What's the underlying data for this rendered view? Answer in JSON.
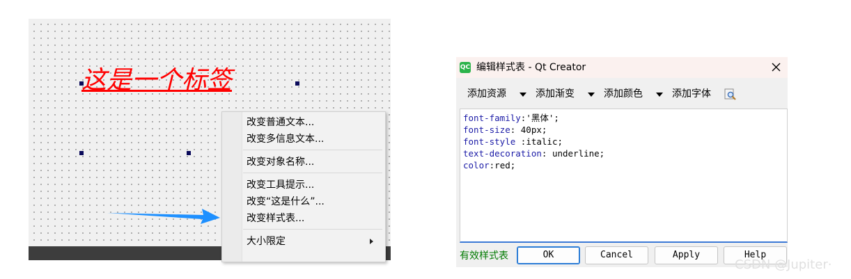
{
  "designer": {
    "label_text": "这是一个标签",
    "label_color": "#ff0000"
  },
  "context_menu": {
    "items": [
      {
        "label": "改变普通文本..."
      },
      {
        "label": "改变多信息文本..."
      },
      {
        "label": "改变对象名称..."
      },
      {
        "label": "改变工具提示..."
      },
      {
        "label": "改变“这是什么”..."
      },
      {
        "label": "改变样式表..."
      },
      {
        "label": "大小限定"
      }
    ]
  },
  "dialog": {
    "title": "编辑样式表 - Qt Creator",
    "app_icon_text": "QC",
    "toolbar": {
      "add_resource": "添加资源",
      "add_gradient": "添加渐变",
      "add_color": "添加颜色",
      "add_font": "添加字体"
    },
    "code": [
      {
        "prop": "font-family",
        "rest": ":'黑体';"
      },
      {
        "prop": "font-size",
        "rest": ": 40px;"
      },
      {
        "prop": "font-style",
        "rest": " :italic;"
      },
      {
        "prop": "text-decoration",
        "rest": ": underline;"
      },
      {
        "prop": "color",
        "rest": ":red;"
      }
    ],
    "status": "有效样式表",
    "buttons": {
      "ok": "OK",
      "cancel": "Cancel",
      "apply": "Apply",
      "help": "Help"
    }
  },
  "watermark": "CSDN @Jupiter·",
  "colors": {
    "accent_blue": "#2b7cd6",
    "arrow_blue": "#1e90ff",
    "keyword_blue": "#1a1aa6",
    "valid_green": "#007a00"
  }
}
